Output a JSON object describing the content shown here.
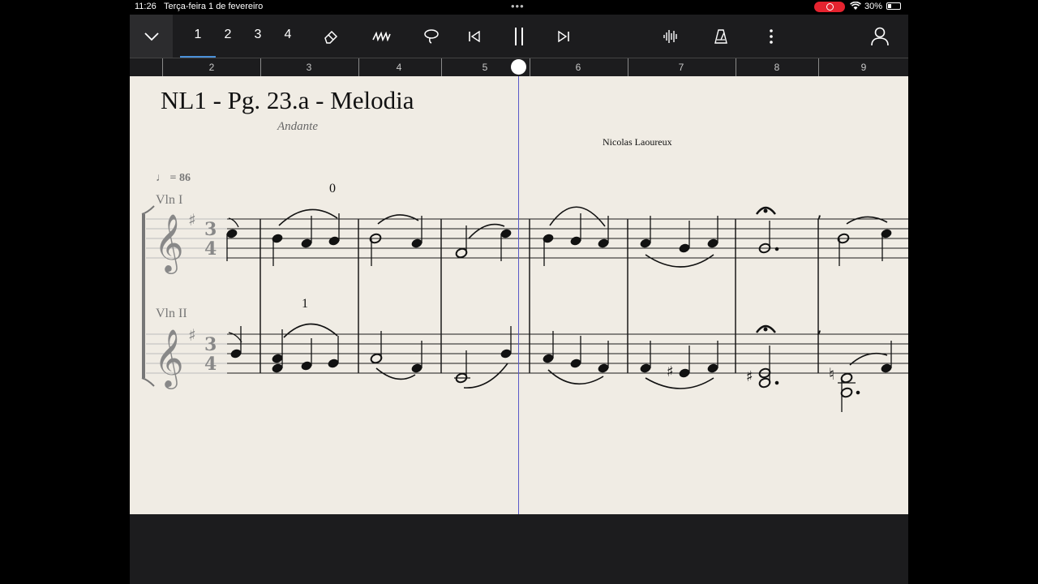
{
  "status": {
    "time": "11:26",
    "date": "Terça-feira 1 de fevereiro",
    "battery_pct": "30%",
    "battery_level": 0.3,
    "recording": true
  },
  "toolbar": {
    "voice_numbers": [
      "1",
      "2",
      "3",
      "4"
    ],
    "selected_voice": "1",
    "icons": [
      "chevron-down-icon",
      "eraser-icon",
      "pen-icon",
      "lasso-icon",
      "skip-back-icon",
      "pause-icon",
      "skip-forward-icon",
      "audio-wave-icon",
      "metronome-icon",
      "more-icon",
      "profile-icon"
    ]
  },
  "ruler": {
    "measures": [
      "2",
      "3",
      "4",
      "5",
      "6",
      "7",
      "8",
      "9"
    ],
    "playhead_position": 5.8
  },
  "score": {
    "title": "NL1 - Pg. 23.a - Melodia",
    "tempo_marking": "Andante",
    "composer": "Nicolas Laoureux",
    "metronome": "= 86",
    "instruments": [
      "Vln I",
      "Vln II"
    ],
    "fingerings": [
      "0",
      "1"
    ],
    "key_signature": "G major (1 sharp)",
    "time_signature": [
      "3",
      "4"
    ]
  },
  "colors": {
    "paper": "#f0ece4",
    "toolbar": "#1c1c1e",
    "accent": "#4a90d9",
    "playhead": "#5a5ac8",
    "record": "#e5232f"
  }
}
